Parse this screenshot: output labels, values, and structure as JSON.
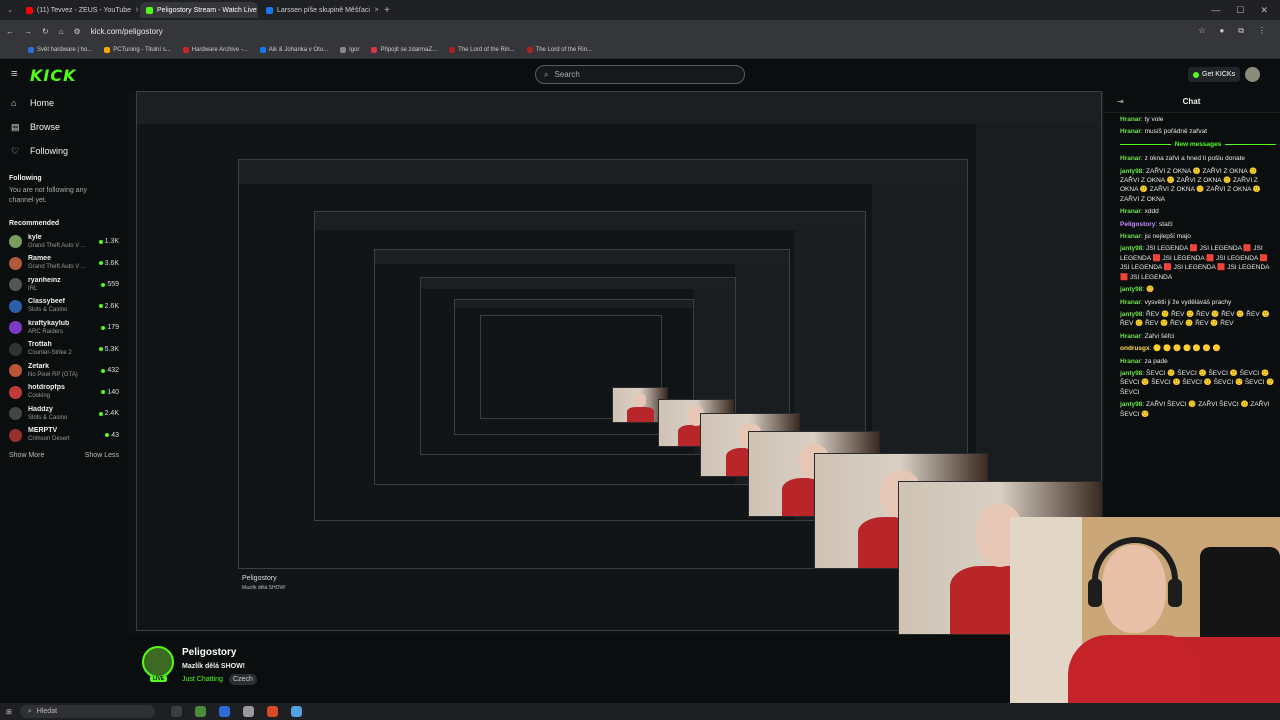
{
  "browser": {
    "tabs": [
      {
        "title": "(11) Tevvez - ZEUS - YouTube",
        "color": "#ff0000",
        "active": false
      },
      {
        "title": "Peligostory Stream - Watch Live",
        "color": "#53fc18",
        "active": true
      },
      {
        "title": "Larssen píše skupině Měšťaci",
        "color": "#1877f2",
        "active": false
      }
    ],
    "url": "kick.com/peligostory",
    "bookmarks": [
      {
        "label": "Svět hardware | ho...",
        "color": "#2b6fdb"
      },
      {
        "label": "PCTuning - Titulní s...",
        "color": "#ffa500"
      },
      {
        "label": "Hardware Archive -...",
        "color": "#cc2222"
      },
      {
        "label": "Aik & Johanka v Otu...",
        "color": "#1877f2"
      },
      {
        "label": "Igor",
        "color": "#888888"
      },
      {
        "label": "Připojit se zdarmaZ...",
        "color": "#dd3344"
      },
      {
        "label": "The Lord of the Rin...",
        "color": "#aa2222"
      },
      {
        "label": "The Lord of the Rin...",
        "color": "#aa2222"
      }
    ]
  },
  "header": {
    "logo": "KICK",
    "search_placeholder": "Search",
    "get_kicks": "Get KICKs"
  },
  "sidebar": {
    "nav": [
      {
        "label": "Home",
        "icon": "⌂"
      },
      {
        "label": "Browse",
        "icon": "▤"
      },
      {
        "label": "Following",
        "icon": "♡"
      }
    ],
    "following_title": "Following",
    "following_note": "You are not following any channel yet.",
    "recommended_title": "Recommended",
    "channels": [
      {
        "name": "kyle",
        "game": "Grand Theft Auto V ...",
        "viewers": "1.3K",
        "color": "#7a9c5c"
      },
      {
        "name": "Ramee",
        "game": "Grand Theft Auto V ...",
        "viewers": "3.6K",
        "color": "#b05a3a"
      },
      {
        "name": "ryanheinz",
        "game": "IRL",
        "viewers": "559",
        "color": "#555555"
      },
      {
        "name": "Classybeef",
        "game": "Slots & Casino",
        "viewers": "2.6K",
        "color": "#2d5ea8"
      },
      {
        "name": "kraftykaylub",
        "game": "ARC Raiders",
        "viewers": "179",
        "color": "#7c3ac4"
      },
      {
        "name": "Trottah",
        "game": "Counter-Strike 2",
        "viewers": "5.3K",
        "color": "#333333"
      },
      {
        "name": "Zetark",
        "game": "No Pixel RP (GTA)",
        "viewers": "432",
        "color": "#bb5533"
      },
      {
        "name": "hotdropfps",
        "game": "Cooking",
        "viewers": "140",
        "color": "#c23b3b"
      },
      {
        "name": "Haddzy",
        "game": "Slots & Casino",
        "viewers": "2.4K",
        "color": "#444444"
      },
      {
        "name": "MERPTV",
        "game": "Crimson Desert",
        "viewers": "43",
        "color": "#9a2f2f"
      }
    ],
    "show_more": "Show More",
    "show_less": "Show Less"
  },
  "stream": {
    "channel": "Peligostory",
    "title": "Mazlík dělá SHOW!",
    "category": "Just Chatting",
    "tag": "Czech",
    "live_badge": "LIVE"
  },
  "chat": {
    "title": "Chat",
    "new_messages": "New messages",
    "messages_before": [
      {
        "user": "Hranar",
        "text": "ty vole",
        "color": "green"
      },
      {
        "user": "Hranar",
        "text": "musíš pořádně zařvat",
        "color": "green"
      }
    ],
    "messages_after": [
      {
        "user": "Hranar",
        "text": "z okna zařvi a hned ti pošlu donate",
        "color": "green"
      },
      {
        "user": "janty98",
        "text": "ZAŘVI Z OKNA 🙂 ZAŘVI Z OKNA 🙂 ZAŘVI Z OKNA 🙂 ZAŘVI Z OKNA 🙂 ZAŘVI Z OKNA 🙂 ZAŘVI Z OKNA 🙂 ZAŘVI Z OKNA 🙂 ZAŘVI Z OKNA",
        "color": "green"
      },
      {
        "user": "Hranar",
        "text": "xddd",
        "color": "green"
      },
      {
        "user": "Peligostory",
        "text": "stačí",
        "color": "purple"
      },
      {
        "user": "Hranar",
        "text": "jsi nejlepší majo",
        "color": "green"
      },
      {
        "user": "janty98",
        "text": "JSI LEGENDA 🟥 JSI LEGENDA 🟥 JSI LEGENDA 🟥 JSI LEGENDA 🟥 JSI LEGENDA 🟥 JSI LEGENDA 🟥 JSI LEGENDA 🟥 JSI LEGENDA 🟥 JSI LEGENDA",
        "color": "green"
      },
      {
        "user": "janty98",
        "text": "🙂",
        "color": "green"
      },
      {
        "user": "Hranar",
        "text": "vysvětli ji že vyděláváš prachy",
        "color": "green"
      },
      {
        "user": "janty98",
        "text": "ŘEV 🙂 ŘEV 🙂 ŘEV 🙂 ŘEV 🙂 ŘEV 🙂 ŘEV 🙂 ŘEV 🙂 ŘEV 🙂 ŘEV 🙂 ŘEV",
        "color": "green"
      },
      {
        "user": "Hranar",
        "text": "Zařvi šéfci",
        "color": "green"
      },
      {
        "user": "ondrusgx",
        "text": "🟡 🟡 🟡 🟡 🟡 🟡 🟡",
        "color": "yellow"
      },
      {
        "user": "Hranar",
        "text": "za pade",
        "color": "green"
      },
      {
        "user": "janty98",
        "text": "ŠEVCI 🙂 ŠEVCI 🙂 ŠEVCI 🙂 ŠEVCI 🙂 ŠEVCI 🙂 ŠEVCI 🙂 ŠEVCI 🙂 ŠEVCI 🙂 ŠEVCI 🙂 ŠEVCI",
        "color": "green"
      },
      {
        "user": "janty98",
        "text": "ZAŘVI ŠEVCI 🙂 ZAŘVI ŠEVCI 🙂 ZAŘVI ŠEVCI 🙂",
        "color": "green"
      }
    ]
  },
  "taskbar": {
    "search": "Hledat",
    "apps": [
      "#3a3d44",
      "#4a8c3a",
      "#2f6bd8",
      "#9a9a9a",
      "#d94a2a",
      "#53a0e0"
    ]
  }
}
